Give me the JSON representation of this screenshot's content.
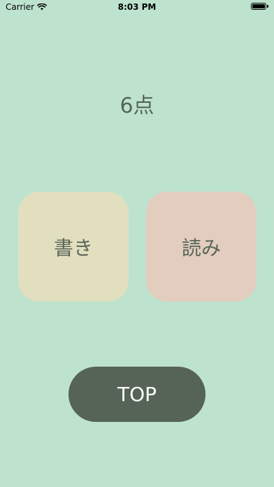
{
  "status_bar": {
    "carrier": "Carrier",
    "time": "8:03 PM",
    "icons": [
      "wifi-icon",
      "battery-icon"
    ]
  },
  "result": {
    "score_text": "6点"
  },
  "choices": {
    "write_label": "書き",
    "read_label": "読み"
  },
  "navigation": {
    "top_label": "TOP"
  },
  "colors": {
    "background": "#bde3cf",
    "write_button": "#e2dfbf",
    "read_button": "#e2cdbf",
    "top_button": "#566357",
    "text": "#556657"
  }
}
